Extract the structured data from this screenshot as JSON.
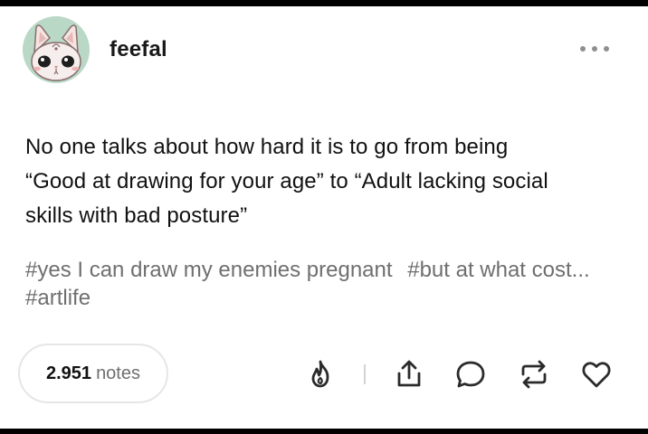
{
  "post": {
    "username": "feefal",
    "avatar_icon": "cat-avatar-icon",
    "avatar_bg": "#b9d8c6",
    "body_lines": [
      "No one talks about how hard it is to go from being",
      "“Good at drawing for your age” to “Adult lacking social",
      "skills with bad posture”"
    ],
    "tags": [
      "#yes I can draw my enemies pregnant",
      "#but at what cost...",
      "#artlife"
    ],
    "notes": {
      "count": "2.951",
      "label": "notes"
    }
  },
  "actions": [
    {
      "icon": "blaze-flame-icon"
    },
    {
      "icon": "share-icon"
    },
    {
      "icon": "reply-icon"
    },
    {
      "icon": "reblog-icon"
    },
    {
      "icon": "like-heart-icon"
    }
  ],
  "colors": {
    "text": "#111111",
    "tag_text": "#6f6f6f",
    "icon_stroke": "#2b2b2b"
  }
}
